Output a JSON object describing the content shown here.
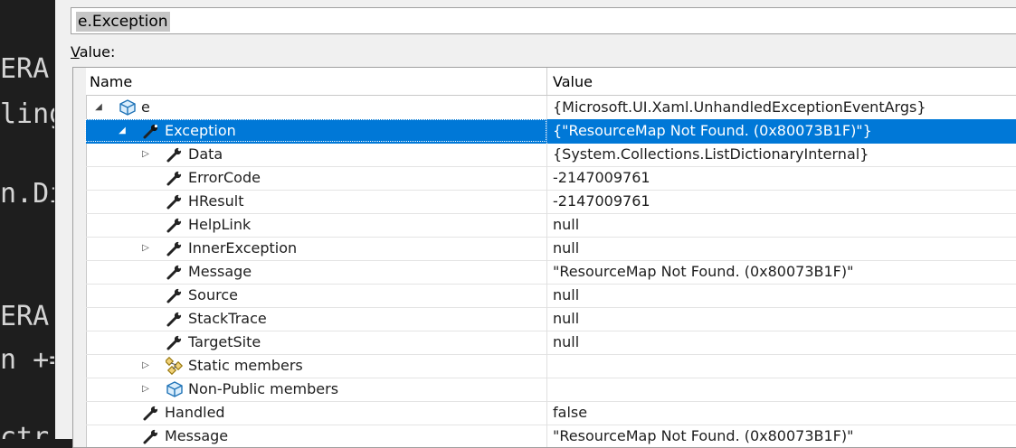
{
  "editor": {
    "code_fragments": [
      "ERA",
      "ling",
      "n.Di",
      "ERA",
      "n +=",
      "ctr"
    ]
  },
  "quickwatch": {
    "expression": "e.Exception",
    "value_label_accel": "V",
    "value_label_rest": "alue:",
    "columns": {
      "name": "Name",
      "value": "Value"
    },
    "rows": [
      {
        "name": "e",
        "value": "{Microsoft.UI.Xaml.UnhandledExceptionEventArgs}",
        "icon": "object-icon",
        "expander": "expanded"
      },
      {
        "name": "Exception",
        "value": "{\"ResourceMap Not Found. (0x80073B1F)\"}",
        "icon": "wrench-icon",
        "expander": "expanded",
        "selected": true
      },
      {
        "name": "Data",
        "value": "{System.Collections.ListDictionaryInternal}",
        "icon": "wrench-icon",
        "expander": "collapsed"
      },
      {
        "name": "ErrorCode",
        "value": "-2147009761",
        "icon": "wrench-icon",
        "expander": "none"
      },
      {
        "name": "HResult",
        "value": "-2147009761",
        "icon": "wrench-icon",
        "expander": "none"
      },
      {
        "name": "HelpLink",
        "value": "null",
        "icon": "wrench-icon",
        "expander": "none"
      },
      {
        "name": "InnerException",
        "value": "null",
        "icon": "wrench-icon",
        "expander": "collapsed"
      },
      {
        "name": "Message",
        "value": "\"ResourceMap Not Found. (0x80073B1F)\"",
        "icon": "wrench-icon",
        "expander": "none"
      },
      {
        "name": "Source",
        "value": "null",
        "icon": "wrench-icon",
        "expander": "none"
      },
      {
        "name": "StackTrace",
        "value": "null",
        "icon": "wrench-icon",
        "expander": "none"
      },
      {
        "name": "TargetSite",
        "value": "null",
        "icon": "wrench-icon",
        "expander": "none"
      },
      {
        "name": "Static members",
        "value": "",
        "icon": "static-members-icon",
        "expander": "collapsed"
      },
      {
        "name": "Non-Public members",
        "value": "",
        "icon": "object-icon",
        "expander": "collapsed"
      },
      {
        "name": "Handled",
        "value": "false",
        "icon": "wrench-icon",
        "expander": "none"
      },
      {
        "name": "Message",
        "value": "\"ResourceMap Not Found. (0x80073B1F)\"",
        "icon": "wrench-icon",
        "expander": "none"
      }
    ]
  },
  "colors": {
    "selection": "#0078d7",
    "dialog_bg": "#f0f0f0",
    "editor_bg": "#1e1e1e"
  }
}
